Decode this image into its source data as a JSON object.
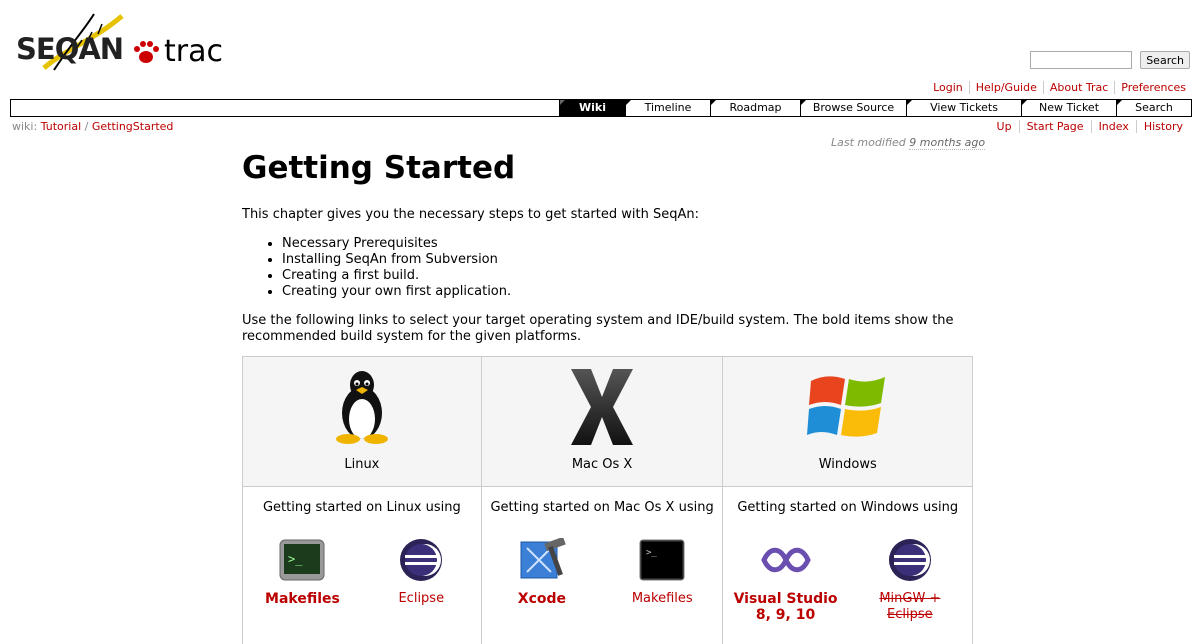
{
  "logo": {
    "seqan": "SEQAN",
    "trac": "trac"
  },
  "search": {
    "placeholder": "",
    "button": "Search"
  },
  "metanav": [
    "Login",
    "Help/Guide",
    "About Trac",
    "Preferences"
  ],
  "mainnav": [
    {
      "label": "Wiki",
      "active": true
    },
    {
      "label": "Timeline"
    },
    {
      "label": "Roadmap"
    },
    {
      "label": "Browse Source"
    },
    {
      "label": "View Tickets"
    },
    {
      "label": "New Ticket"
    },
    {
      "label": "Search"
    }
  ],
  "breadcrumb": {
    "prefix": "wiki:",
    "tutorial": "Tutorial",
    "sep": "/",
    "page": "GettingStarted"
  },
  "ctxtnav": [
    "Up",
    "Start Page",
    "Index",
    "History"
  ],
  "lastmod": {
    "prefix": "Last modified",
    "ago": "9 months ago"
  },
  "content": {
    "title": "Getting Started",
    "intro": "This chapter gives you the necessary steps to get started with SeqAn:",
    "steps": [
      "Necessary Prerequisites",
      "Installing SeqAn from Subversion",
      "Creating a first build.",
      "Creating your own first application."
    ],
    "links_text": "Use the following links to select your target operating system and IDE/build system. The bold items show the recommended build system for the given platforms."
  },
  "platforms": [
    {
      "name": "Linux",
      "using": "Getting started on Linux using",
      "tools": [
        {
          "label": "Makefiles",
          "bold": true,
          "icon": "terminal-green-icon"
        },
        {
          "label": "Eclipse",
          "icon": "eclipse-icon"
        }
      ]
    },
    {
      "name": "Mac Os X",
      "using": "Getting started on Mac Os X using",
      "tools": [
        {
          "label": "Xcode",
          "bold": true,
          "icon": "xcode-icon"
        },
        {
          "label": "Makefiles",
          "icon": "terminal-icon"
        }
      ]
    },
    {
      "name": "Windows",
      "using": "Getting started on Windows using",
      "tools": [
        {
          "label": "Visual Studio 8, 9, 10",
          "bold": true,
          "icon": "visual-studio-icon"
        },
        {
          "label": "MinGW + Eclipse",
          "strike": true,
          "icon": "eclipse-icon"
        }
      ]
    }
  ],
  "colors": {
    "link": "#bb0000",
    "nav_active": "#000000"
  }
}
